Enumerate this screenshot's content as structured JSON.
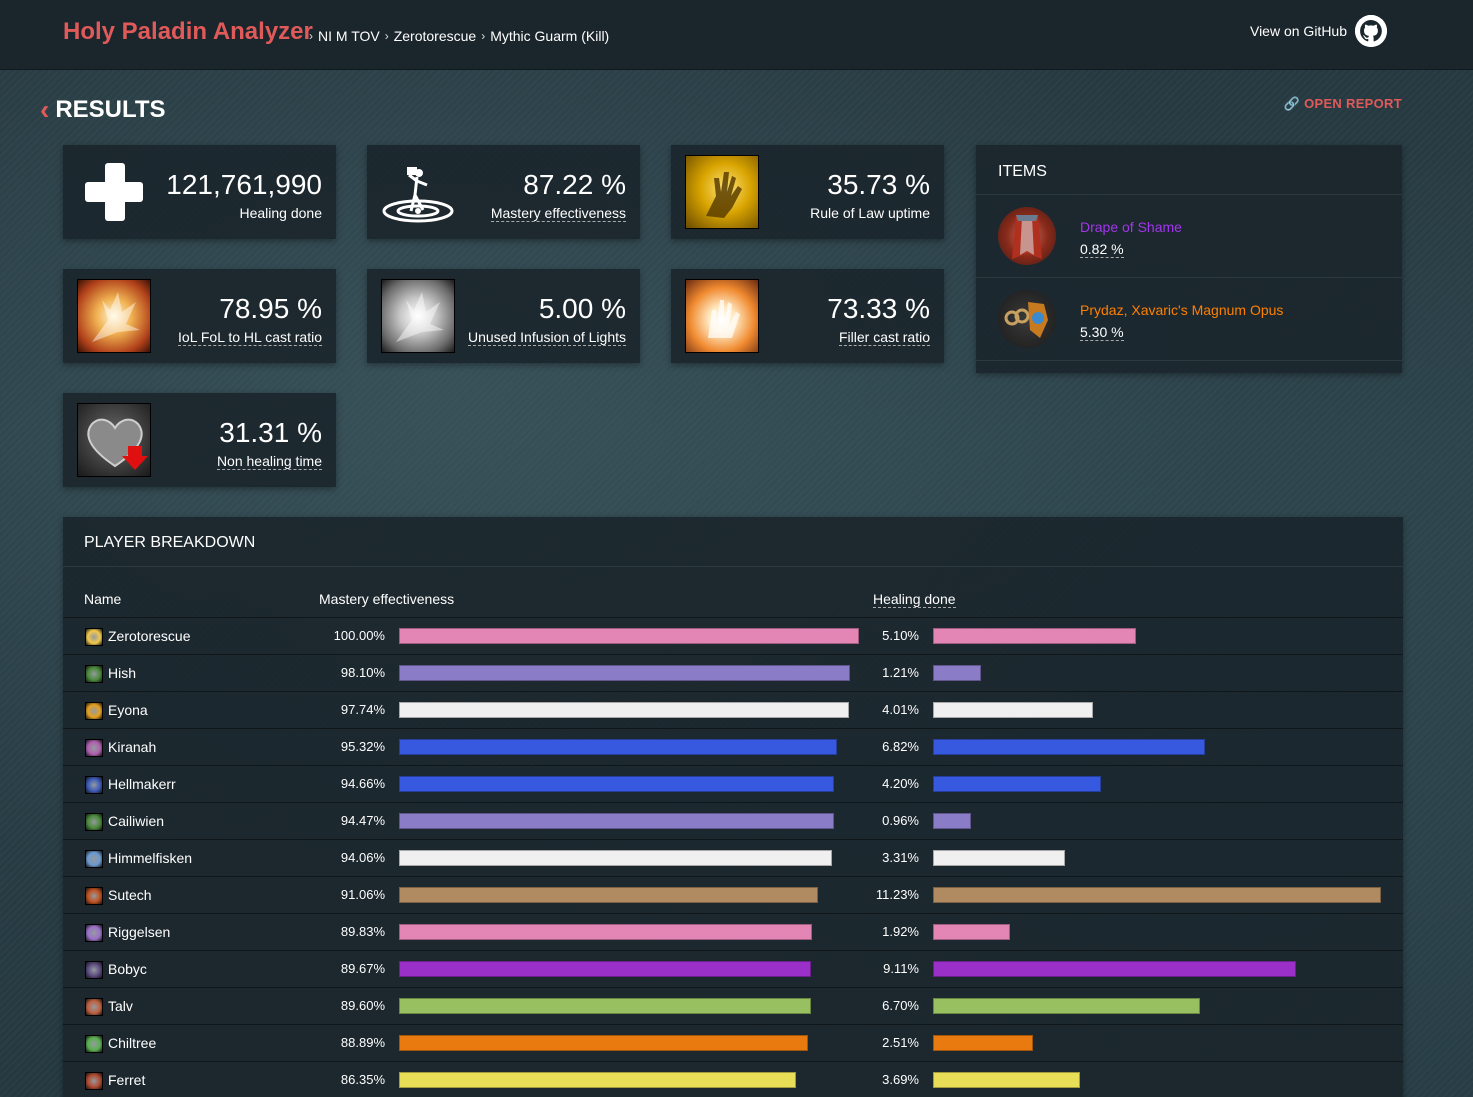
{
  "header": {
    "brand": "Holy Paladin Analyzer",
    "breadcrumbs": [
      "NI M TOV",
      "Zerotorescue",
      "Mythic Guarm (Kill)"
    ],
    "github_label": "View on GitHub"
  },
  "results": {
    "title": "RESULTS",
    "open_report": "OPEN REPORT"
  },
  "stats": [
    {
      "value": "121,761,990",
      "label": "Healing done",
      "icon": "healing-cross-icon"
    },
    {
      "value": "87.22 %",
      "label": "Mastery effectiveness",
      "icon": "mastery-icon"
    },
    {
      "value": "35.73 %",
      "label": "Rule of Law uptime",
      "icon": "rule-of-law-icon"
    },
    {
      "value": "78.95 %",
      "label": "IoL FoL to HL cast ratio",
      "icon": "infusion-of-light-icon"
    },
    {
      "value": "5.00 %",
      "label": "Unused Infusion of Lights",
      "icon": "unused-infusion-icon"
    },
    {
      "value": "73.33 %",
      "label": "Filler cast ratio",
      "icon": "filler-cast-icon"
    },
    {
      "value": "31.31 %",
      "label": "Non healing time",
      "icon": "non-healing-heart-icon"
    }
  ],
  "items": {
    "title": "ITEMS",
    "list": [
      {
        "name": "Drape of Shame",
        "pct": "0.82 %",
        "color": "#a335ee",
        "icon": "drape-of-shame-icon"
      },
      {
        "name": "Prydaz, Xavaric's Magnum Opus",
        "pct": "5.30 %",
        "color": "#ff8000",
        "icon": "prydaz-necklace-icon"
      }
    ]
  },
  "breakdown": {
    "title": "PLAYER BREAKDOWN",
    "col_name": "Name",
    "col_mastery": "Mastery effectiveness",
    "col_healing": "Healing done",
    "rows": [
      {
        "name": "Zerotorescue",
        "mastery": "100.00%",
        "mastery_frac": 1.0,
        "healing": "5.10%",
        "color": "#e386b5",
        "spec_color": "#f2c94c"
      },
      {
        "name": "Hish",
        "mastery": "98.10%",
        "mastery_frac": 0.981,
        "healing": "1.21%",
        "color": "#8b7cc8",
        "spec_color": "#4a8a3a"
      },
      {
        "name": "Eyona",
        "mastery": "97.74%",
        "mastery_frac": 0.9774,
        "healing": "4.01%",
        "color": "#f0f0f0",
        "spec_color": "#e6a020"
      },
      {
        "name": "Kiranah",
        "mastery": "95.32%",
        "mastery_frac": 0.9532,
        "healing": "6.82%",
        "color": "#3759e0",
        "spec_color": "#b05fb0"
      },
      {
        "name": "Hellmakerr",
        "mastery": "94.66%",
        "mastery_frac": 0.9466,
        "healing": "4.20%",
        "color": "#3759e0",
        "spec_color": "#3a5ab8"
      },
      {
        "name": "Cailiwien",
        "mastery": "94.47%",
        "mastery_frac": 0.9447,
        "healing": "0.96%",
        "color": "#8b7cc8",
        "spec_color": "#4a8a3a"
      },
      {
        "name": "Himmelfisken",
        "mastery": "94.06%",
        "mastery_frac": 0.9406,
        "healing": "3.31%",
        "color": "#f0f0f0",
        "spec_color": "#6a9ad0"
      },
      {
        "name": "Sutech",
        "mastery": "91.06%",
        "mastery_frac": 0.9106,
        "healing": "11.23%",
        "color": "#b08a60",
        "spec_color": "#c0501e"
      },
      {
        "name": "Riggelsen",
        "mastery": "89.83%",
        "mastery_frac": 0.8983,
        "healing": "1.92%",
        "color": "#e386b5",
        "spec_color": "#9a70c8"
      },
      {
        "name": "Bobyc",
        "mastery": "89.67%",
        "mastery_frac": 0.8967,
        "healing": "9.11%",
        "color": "#9a30c8",
        "spec_color": "#5a4a80"
      },
      {
        "name": "Talv",
        "mastery": "89.60%",
        "mastery_frac": 0.896,
        "healing": "6.70%",
        "color": "#98c060",
        "spec_color": "#c06040"
      },
      {
        "name": "Chiltree",
        "mastery": "88.89%",
        "mastery_frac": 0.8889,
        "healing": "2.51%",
        "color": "#e87a10",
        "spec_color": "#5ab050"
      },
      {
        "name": "Ferret",
        "mastery": "86.35%",
        "mastery_frac": 0.8635,
        "healing": "3.69%",
        "color": "#e8de58",
        "spec_color": "#b04a30"
      }
    ]
  }
}
